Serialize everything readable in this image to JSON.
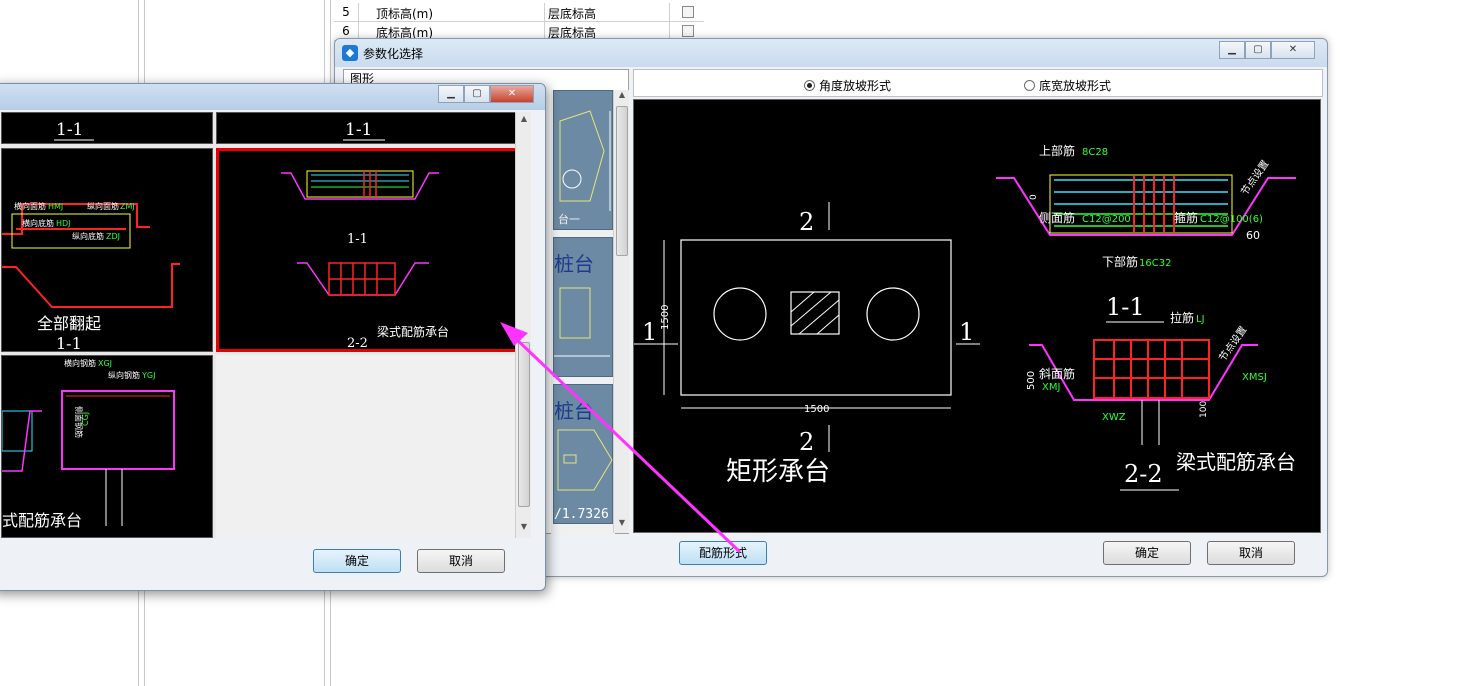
{
  "background_table": {
    "rows": [
      {
        "num": "5",
        "name": "顶标高(m)",
        "value": "层底标高"
      },
      {
        "num": "6",
        "name": "底标高(m)",
        "value": "层底标高"
      }
    ]
  },
  "main_dialog": {
    "title": "参数化选择",
    "panel_header": "图形",
    "radio_angle": "角度放坡形式",
    "radio_width": "底宽放坡形式",
    "btn_rebar": "配筋形式",
    "btn_ok": "确定",
    "btn_cancel": "取消",
    "thumb_labels": [
      "台一",
      "桩台",
      "桩台"
    ],
    "thumb_value": "/1.7326",
    "drawing": {
      "rect_title": "矩形承台",
      "sec_2_top": "2",
      "sec_2_bottom": "2",
      "sec_1_left": "1",
      "sec_1_right": "1",
      "dim_height": "1500",
      "dim_width": "1500",
      "s11_label": "1-1",
      "s22_label": "2-2",
      "beam_title": "梁式配筋承台",
      "top_bar": "上部筋",
      "top_bar_val": "8C28",
      "side_bar": "侧面筋",
      "side_bar_val": "C12@200",
      "stirrup": "箍筋",
      "stirrup_val": "C12@100(6)",
      "bottom_bar": "下部筋",
      "bottom_bar_val": "16C32",
      "slope_angle": "60",
      "node_setting": "节点设置",
      "tie_bar": "拉筋",
      "tie_bar_val": "LJ",
      "slope_bar": "斜面筋",
      "slope_bar_val": "XMJ",
      "xmsj": "XMSJ",
      "xwz": "XWZ",
      "dim_500": "500",
      "dim_100": "100",
      "dim_0": "0"
    }
  },
  "front_dialog": {
    "btn_ok": "确定",
    "btn_cancel": "取消",
    "cells": {
      "c1_label": "1-1",
      "c2_label": "1-1",
      "c3_title": "全部翻起",
      "c3_label": "1-1",
      "c3_hmj": "横向面筋",
      "c3_hmj_val": "HMJ",
      "c3_zmj": "纵向面筋",
      "c3_zmj_val": "ZMJ",
      "c3_hdj": "横向底筋",
      "c3_hdj_val": "HDJ",
      "c3_zdj": "纵向底筋",
      "c3_zdj_val": "ZDJ",
      "c4_title": "梁式配筋承台",
      "c4_s11": "1-1",
      "c4_s22": "2-2",
      "c5_hxgj": "横向钢筋",
      "c5_hxgj_val": "XGJ",
      "c5_zxgj": "纵向钢筋",
      "c5_zxgj_val": "YGJ",
      "c5_cmgj": "侧面钢筋",
      "c5_cmgj_val": "CGJ",
      "c5_title": "式配筋承台"
    }
  },
  "colors": {
    "arrow": "#ff33ff",
    "rebar_red": "#ff2222",
    "rebar_green": "#33ff33",
    "rebar_cyan": "#33e6ff",
    "rebar_yellow": "#ffff33",
    "magenta": "#ff33ff"
  }
}
